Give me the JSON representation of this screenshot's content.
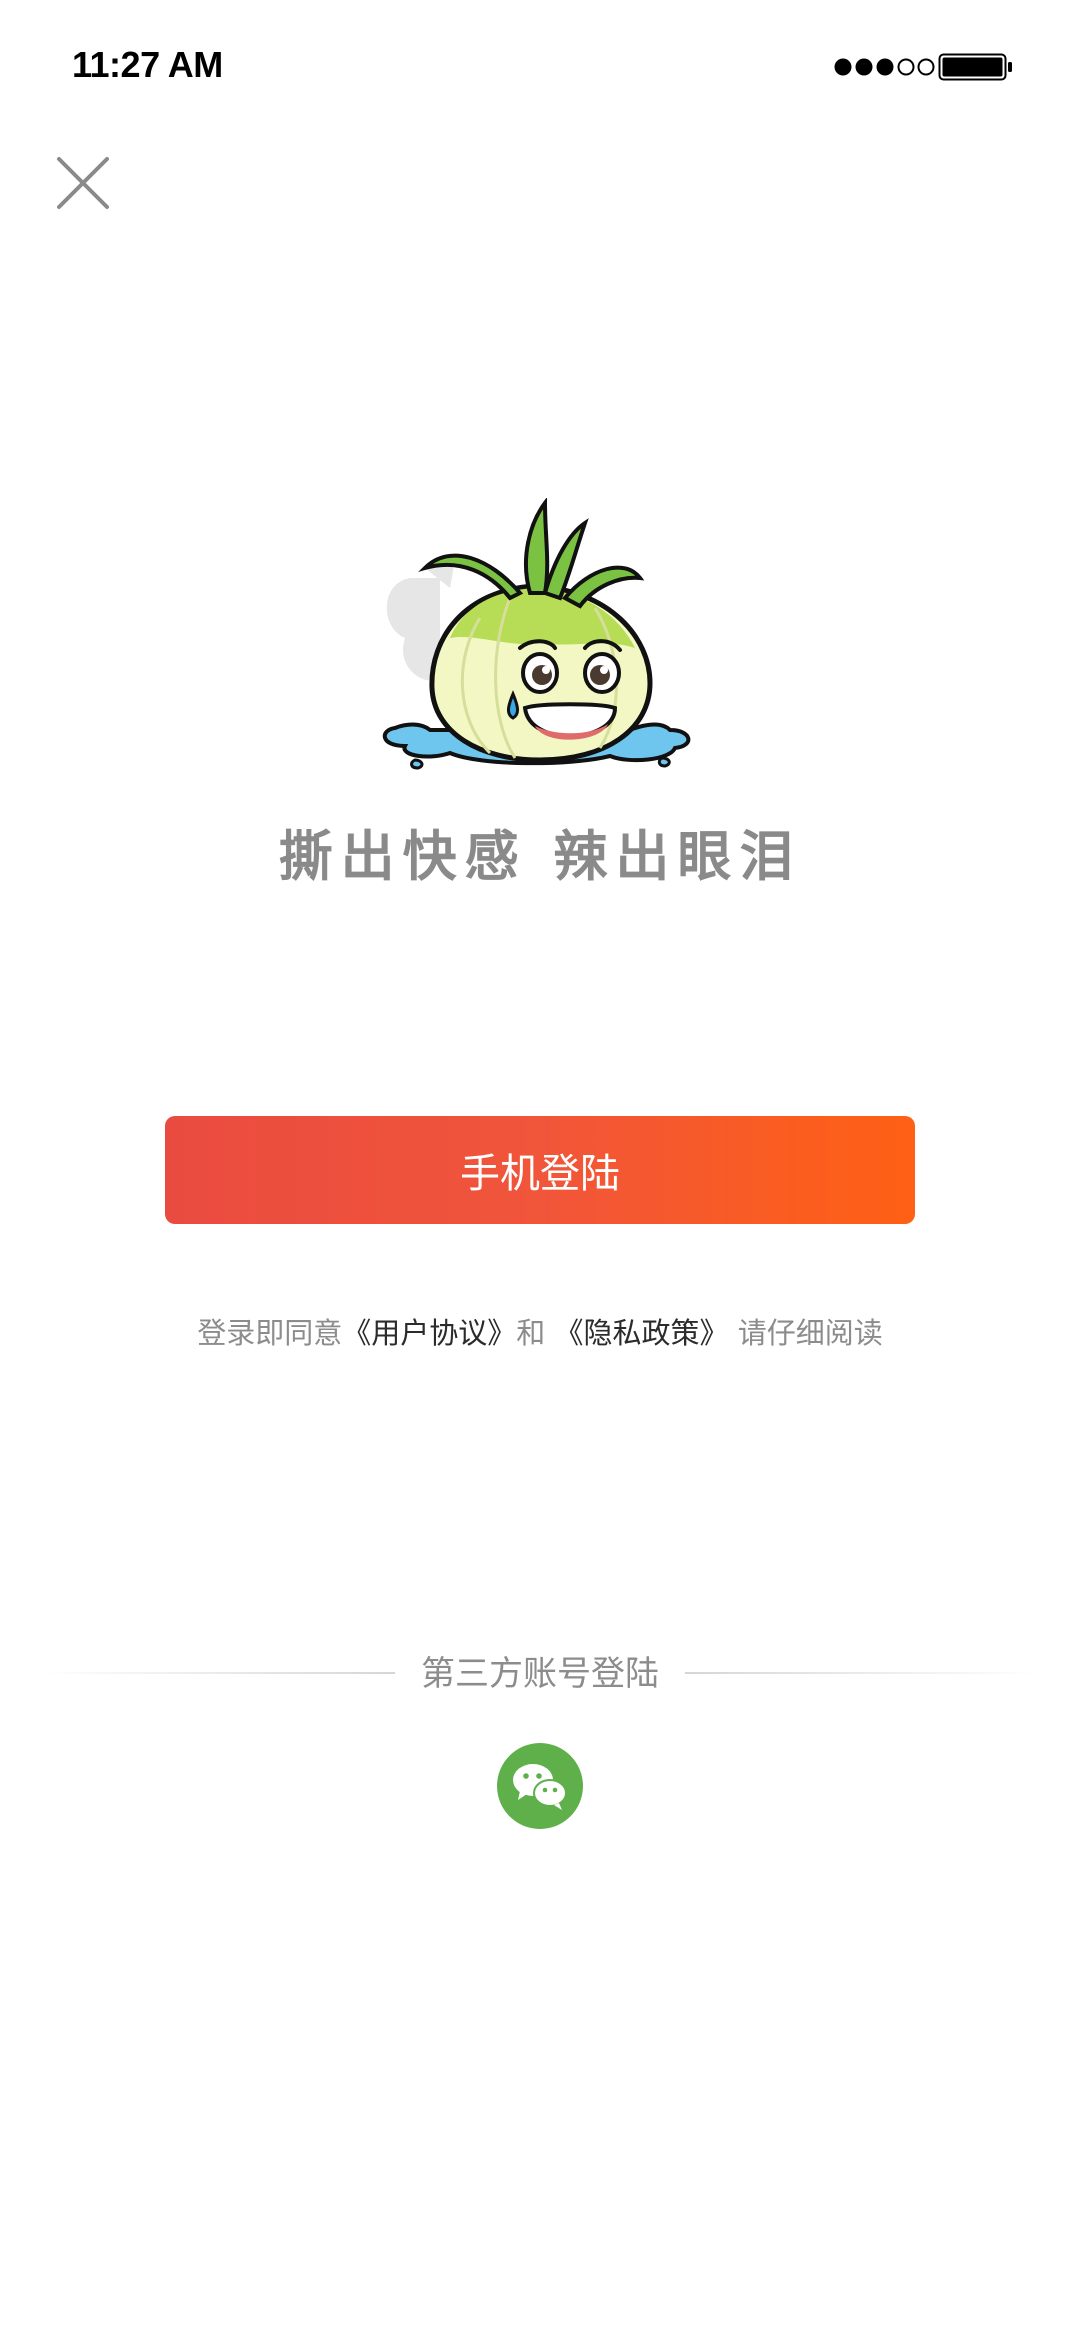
{
  "status_bar": {
    "time": "11:27 AM",
    "signal_icon": "signal-dots-icon",
    "battery_icon": "battery-full-icon"
  },
  "header": {
    "close_icon": "close-icon"
  },
  "hero": {
    "mascot": "onion-mascot-icon",
    "slogan": "撕出快感 辣出眼泪"
  },
  "login": {
    "phone_login_label": "手机登陆",
    "button_gradient": [
      "#ea4b40",
      "#ff6014"
    ]
  },
  "agreement": {
    "prefix": "登录即同意",
    "user_agreement": "《用户协议》",
    "conjunction": "和 ",
    "privacy_policy": "《隐私政策》",
    "suffix": " 请仔细阅读"
  },
  "third_party": {
    "label": "第三方账号登陆",
    "wechat_icon": "wechat-icon",
    "wechat_color": "#5fb04a"
  }
}
